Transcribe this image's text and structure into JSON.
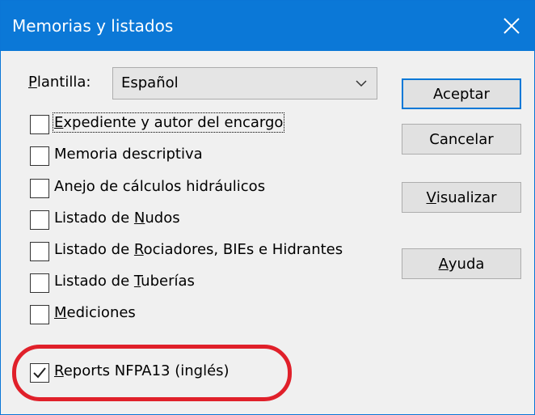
{
  "window": {
    "title": "Memorias y listados",
    "close_icon": "close-icon"
  },
  "template": {
    "label": "Plantilla:",
    "label_accesskey": "P",
    "label_rest": "lantilla:",
    "selected": "Español",
    "arrow_icon": "chevron-down-icon"
  },
  "checkboxes": [
    {
      "pre": "",
      "key": "E",
      "post": "xpediente y autor del encargo",
      "checked": false
    },
    {
      "pre": "",
      "key": "M",
      "post": "emoria descriptiva",
      "checked": false
    },
    {
      "pre": "",
      "key": "A",
      "post": "nejo de cálculos hidráulicos",
      "checked": false
    },
    {
      "pre": "Listado de ",
      "key": "N",
      "post": "udos",
      "checked": false
    },
    {
      "pre": "Listado de ",
      "key": "R",
      "post": "ociadores, BIEs e Hidrantes",
      "checked": false
    },
    {
      "pre": "Listado de ",
      "key": "T",
      "post": "uberías",
      "checked": false
    },
    {
      "pre": "",
      "key": "M",
      "post": "ediciones",
      "checked": false
    },
    {
      "pre": "",
      "key": "R",
      "post": "eports NFPA13 (inglés)",
      "checked": true
    }
  ],
  "buttons": {
    "accept": "Aceptar",
    "cancel": "Cancelar",
    "preview_key": "V",
    "preview_rest": "isualizar",
    "help_key": "A",
    "help_rest": "yuda"
  },
  "colors": {
    "titlebar": "#0b78d7",
    "highlight": "#e0202a",
    "default_button_border": "#0078d7"
  }
}
